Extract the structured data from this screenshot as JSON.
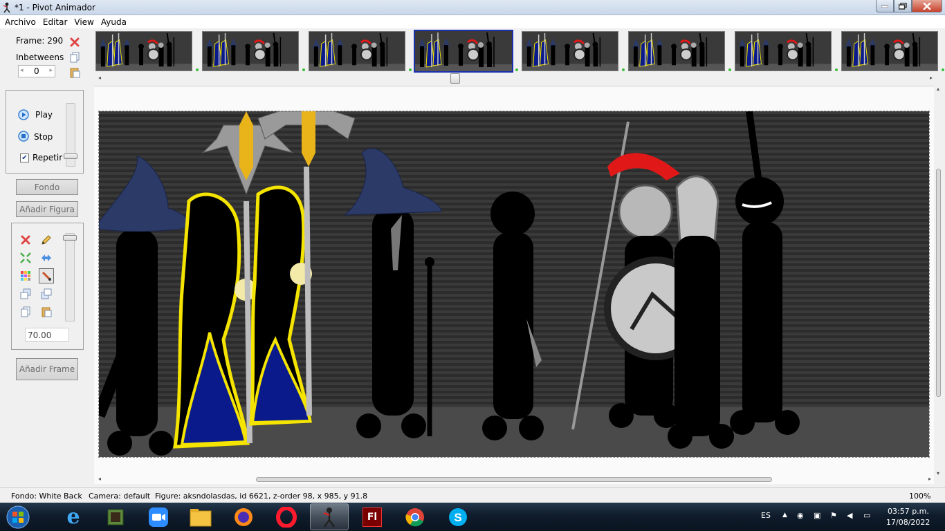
{
  "window": {
    "title": "*1 - Pivot Animador",
    "buttons": {
      "minimize": "minimize-icon",
      "maximize": "maximize-icon",
      "close": "close-icon"
    }
  },
  "menu": [
    "Archivo",
    "Editar",
    "View",
    "Ayuda"
  ],
  "frame_panel": {
    "frame_label": "Frame: 290",
    "inbetweens_label": "Inbetweens",
    "inbetweens_value": "0"
  },
  "playback": {
    "play": "Play",
    "stop": "Stop",
    "repeat": "Repetir",
    "repeat_checked": true
  },
  "buttons": {
    "fondo": "Fondo",
    "add_figure": "Añadir Figura",
    "add_frame": "Añadir Frame"
  },
  "tools": {
    "scale_value": "70.00",
    "icons": [
      "delete-icon",
      "edit-icon",
      "center-icon",
      "flip-icon",
      "color-icon",
      "brush-icon",
      "bring-front-icon",
      "send-back-icon",
      "copy-icon",
      "paste-icon"
    ]
  },
  "frames": {
    "count": 8,
    "selected_index": 3
  },
  "status": {
    "fondo": "Fondo: White Back",
    "camera": "Camera: default",
    "figure": "Figure: aksndolasdas,  id 6621,  z-order 98,  x 985, y 91.8",
    "zoom": "100%"
  },
  "taskbar": {
    "apps": [
      "start-orb-icon",
      "internet-explorer-icon",
      "minecraft-icon",
      "zoom-icon",
      "file-explorer-icon",
      "firefox-icon",
      "opera-icon",
      "pivot-animator-icon",
      "flash-icon",
      "chrome-icon",
      "skype-icon"
    ],
    "active_index": 7,
    "language": "ES",
    "time": "03:57 p.m.",
    "date": "17/08/2022"
  },
  "colors": {
    "selection": "#1a2fb0",
    "stage_bg": "#333333",
    "robe_blue": "#0a1a8a",
    "robe_outline": "#f4e400",
    "hat_blue": "#2b3a66",
    "crest_red": "#e01818",
    "gold": "#e8b41a"
  }
}
